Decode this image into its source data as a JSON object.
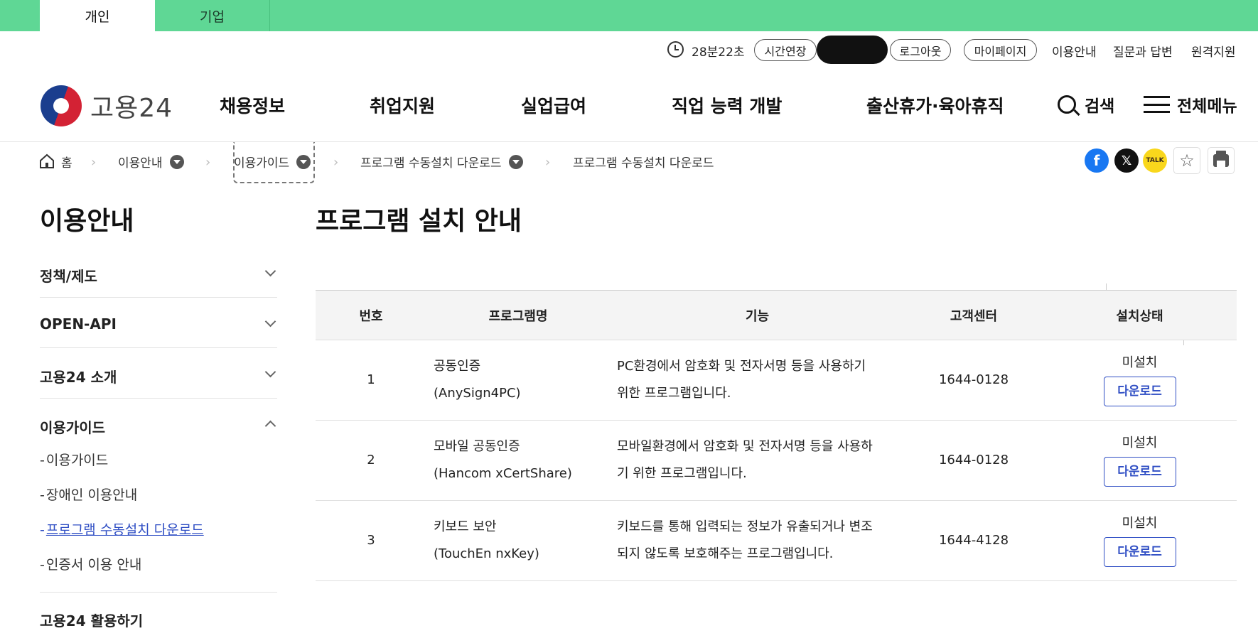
{
  "top_tabs": {
    "personal": "개인",
    "corporate": "기업"
  },
  "util": {
    "timer": "28분22초",
    "extend": "시간연장",
    "logout": "로그아웃",
    "mypage": "마이페이지",
    "links": [
      "이용안내",
      "질문과 답변",
      "원격지원"
    ]
  },
  "header": {
    "logo_text": "고용24",
    "gnb": [
      "채용정보",
      "취업지원",
      "실업급여",
      "직업 능력 개발",
      "출산휴가·육아휴직"
    ],
    "search": "검색",
    "all_menu": "전체메뉴"
  },
  "breadcrumb": {
    "home": "홈",
    "items": [
      "이용안내",
      "이용가이드",
      "프로그램 수동설치 다운로드",
      "프로그램 수동설치 다운로드"
    ]
  },
  "share": {
    "kakao": "TALK"
  },
  "sidebar": {
    "title": "이용안내",
    "sections": [
      "정책/제도",
      "OPEN-API",
      "고용24 소개",
      "이용가이드",
      "고용24 활용하기"
    ],
    "sub_items": [
      "이용가이드",
      "장애인 이용안내",
      "프로그램 수동설치 다운로드",
      "인증서 이용 안내"
    ],
    "sub_prefix": "-"
  },
  "content": {
    "title": "프로그램 설치 안내",
    "table": {
      "headers": [
        "번호",
        "프로그램명",
        "기능",
        "고객센터",
        "설치상태"
      ],
      "rows": [
        {
          "num": "1",
          "name1": "공동인증",
          "name2": "(AnySign4PC)",
          "func1": "PC환경에서 암호화 및 전자서명 등을 사용하기",
          "func2": "위한 프로그램입니다.",
          "cs": "1644-0128",
          "status": "미설치",
          "button": "다운로드"
        },
        {
          "num": "2",
          "name1": "모바일 공동인증",
          "name2": "(Hancom xCertShare)",
          "func1": "모바일환경에서 암호화 및 전자서명 등을 사용하",
          "func2": "기 위한 프로그램입니다.",
          "cs": "1644-0128",
          "status": "미설치",
          "button": "다운로드"
        },
        {
          "num": "3",
          "name1": "키보드 보안",
          "name2": "(TouchEn nxKey)",
          "func1": "키보드를 통해 입력되는 정보가 유출되거나 변조",
          "func2": "되지 않도록 보호해주는 프로그램입니다.",
          "cs": "1644-4128",
          "status": "미설치",
          "button": "다운로드"
        }
      ]
    }
  },
  "colors": {
    "brand_green": "#5fd795",
    "link_blue": "#2f4ec4"
  }
}
